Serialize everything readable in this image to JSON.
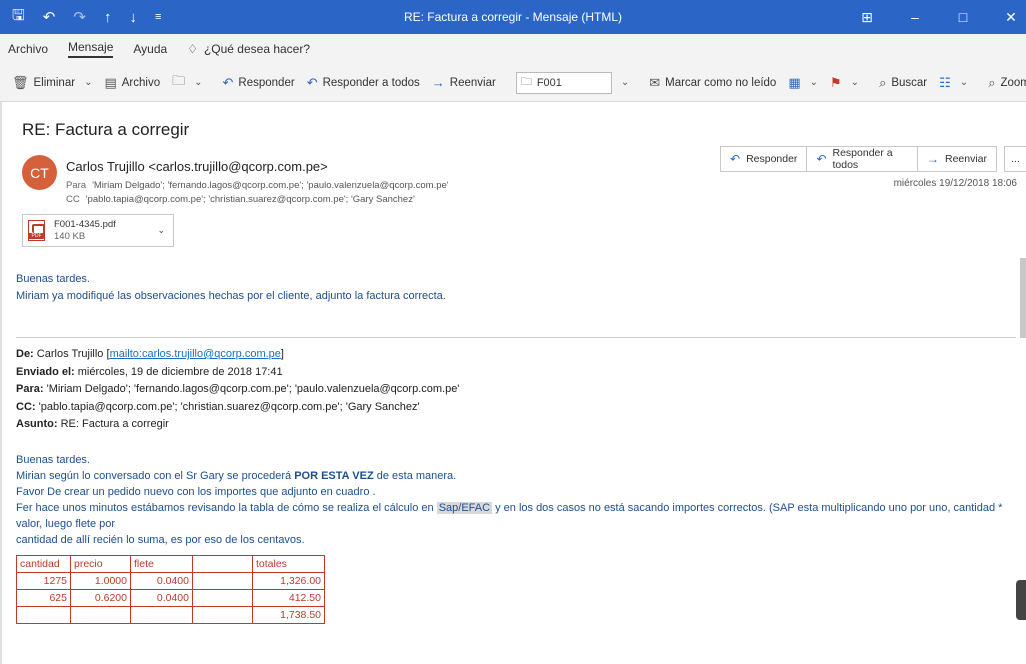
{
  "window": {
    "title": "RE: Factura a corregir  -  Mensaje (HTML)",
    "quick_icons": [
      "save-icon",
      "undo-icon",
      "redo-icon",
      "up-arrow-icon",
      "down-arrow-icon",
      "customize-icon"
    ],
    "controls": [
      "ribbon-display-icon",
      "minimize-icon",
      "restore-icon",
      "close-icon"
    ]
  },
  "menu": {
    "archivo": "Archivo",
    "mensaje": "Mensaje",
    "ayuda": "Ayuda",
    "tellme": "¿Qué desea hacer?"
  },
  "ribbon": {
    "eliminar": "Eliminar",
    "archivo": "Archivo",
    "responder": "Responder",
    "responder_todos": "Responder a todos",
    "reenviar": "Reenviar",
    "quick_step": "F001",
    "marcar": "Marcar como no leído",
    "buscar": "Buscar",
    "zoom": "Zoom"
  },
  "message": {
    "subject": "RE: Factura a corregir",
    "avatar_initials": "CT",
    "sender": "Carlos Trujillo <carlos.trujillo@qcorp.com.pe>",
    "to_label": "Para",
    "to": "'Miriam Delgado'; 'fernando.lagos@qcorp.com.pe'; 'paulo.valenzuela@qcorp.com.pe'",
    "cc_label": "CC",
    "cc": "'pablo.tapia@qcorp.com.pe'; 'christian.suarez@qcorp.com.pe'; 'Gary Sanchez'",
    "date": "miércoles 19/12/2018 18:06",
    "actions": {
      "responder": "Responder",
      "responder_todos": "Responder a todos",
      "reenviar": "Reenviar",
      "more": "..."
    },
    "attachment": {
      "name": "F001-4345.pdf",
      "size": "140 KB"
    }
  },
  "body": {
    "greeting": "Buenas tardes.",
    "line1": "Miriam ya modifiqué las observaciones hechas por el cliente, adjunto la factura correcta."
  },
  "original": {
    "de_label": "De:",
    "de_name": "Carlos Trujillo",
    "de_link": "mailto:carlos.trujillo@qcorp.com.pe",
    "enviado_label": "Enviado el:",
    "enviado": "miércoles, 19 de diciembre de 2018 17:41",
    "para_label": "Para:",
    "para": "'Miriam Delgado'; 'fernando.lagos@qcorp.com.pe'; 'paulo.valenzuela@qcorp.com.pe'",
    "cc_label": "CC:",
    "cc": "'pablo.tapia@qcorp.com.pe'; 'christian.suarez@qcorp.com.pe'; 'Gary Sanchez'",
    "asunto_label": "Asunto:",
    "asunto": "RE: Factura a corregir",
    "greeting": "Buenas tardes.",
    "l1_a": "Mirian según lo conversado con el Sr Gary se procederá ",
    "l1_b": "POR ESTA VEZ",
    "l1_c": " de esta manera.",
    "l2": "Favor De crear un pedido nuevo con los importes que adjunto en cuadro .",
    "l3_a": "Fer hace unos minutos estábamos revisando la tabla de cómo se realiza el cálculo en ",
    "l3_hl": "Sap/EFAC",
    "l3_b": " y en los dos casos no está sacando importes correctos. (SAP esta multiplicando uno por uno, cantidad * valor, luego flete por",
    "l4": "cantidad de allí recién lo suma, es por eso de los centavos."
  },
  "table": {
    "headers": [
      "cantidad",
      "precio",
      "flete",
      "",
      "totales"
    ],
    "rows": [
      [
        "1275",
        "1.0000",
        "0.0400",
        "",
        "1,326.00"
      ],
      [
        "625",
        "0.6200",
        "0.0400",
        "",
        "412.50"
      ],
      [
        "",
        "",
        "",
        "",
        "1,738.50"
      ]
    ]
  }
}
